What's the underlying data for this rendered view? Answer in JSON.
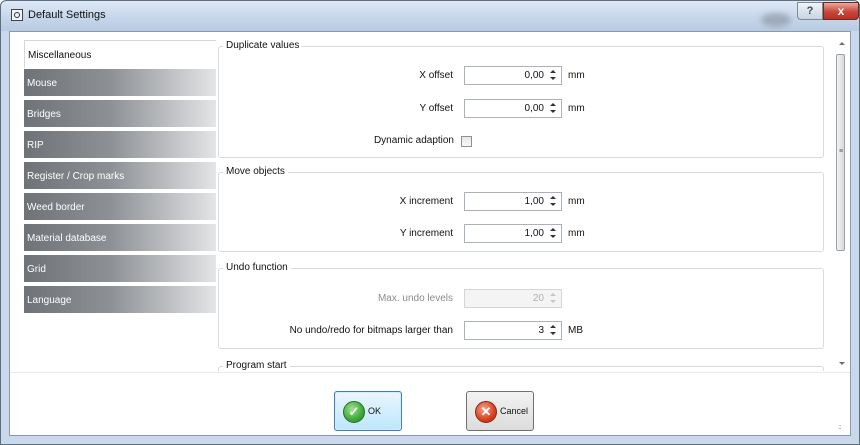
{
  "window": {
    "title": "Default Settings",
    "help_label": "?",
    "close_label": "x"
  },
  "sidebar": {
    "items": [
      {
        "label": "Miscellaneous",
        "active": true
      },
      {
        "label": "Mouse",
        "active": false
      },
      {
        "label": "Bridges",
        "active": false
      },
      {
        "label": "RIP",
        "active": false
      },
      {
        "label": "Register / Crop marks",
        "active": false
      },
      {
        "label": "Weed border",
        "active": false
      },
      {
        "label": "Material database",
        "active": false
      },
      {
        "label": "Grid",
        "active": false
      },
      {
        "label": "Language",
        "active": false
      }
    ]
  },
  "duplicate": {
    "legend": "Duplicate values",
    "x_offset": {
      "label": "X offset",
      "value": "0,00",
      "unit": "mm"
    },
    "y_offset": {
      "label": "Y offset",
      "value": "0,00",
      "unit": "mm"
    },
    "dynamic_adaption": {
      "label": "Dynamic adaption",
      "checked": false
    }
  },
  "move": {
    "legend": "Move objects",
    "x_increment": {
      "label": "X increment",
      "value": "1,00",
      "unit": "mm"
    },
    "y_increment": {
      "label": "Y increment",
      "value": "1,00",
      "unit": "mm"
    }
  },
  "undo": {
    "legend": "Undo function",
    "max_levels": {
      "label": "Max. undo levels",
      "value": "20",
      "enabled": false
    },
    "bitmap_limit": {
      "label": "No undo/redo for bitmaps larger than",
      "value": "3",
      "unit": "MB"
    }
  },
  "program_start": {
    "legend": "Program start"
  },
  "buttons": {
    "ok_label": "OK",
    "cancel_label": "Cancel"
  },
  "colors": {
    "ok_accent": "#3ea93a",
    "cancel_accent": "#d9401f",
    "title_bar": "#c6d6ea"
  },
  "icons": {
    "title": "app-icon",
    "ok": "checkmark-icon",
    "cancel": "x-circle-icon"
  }
}
